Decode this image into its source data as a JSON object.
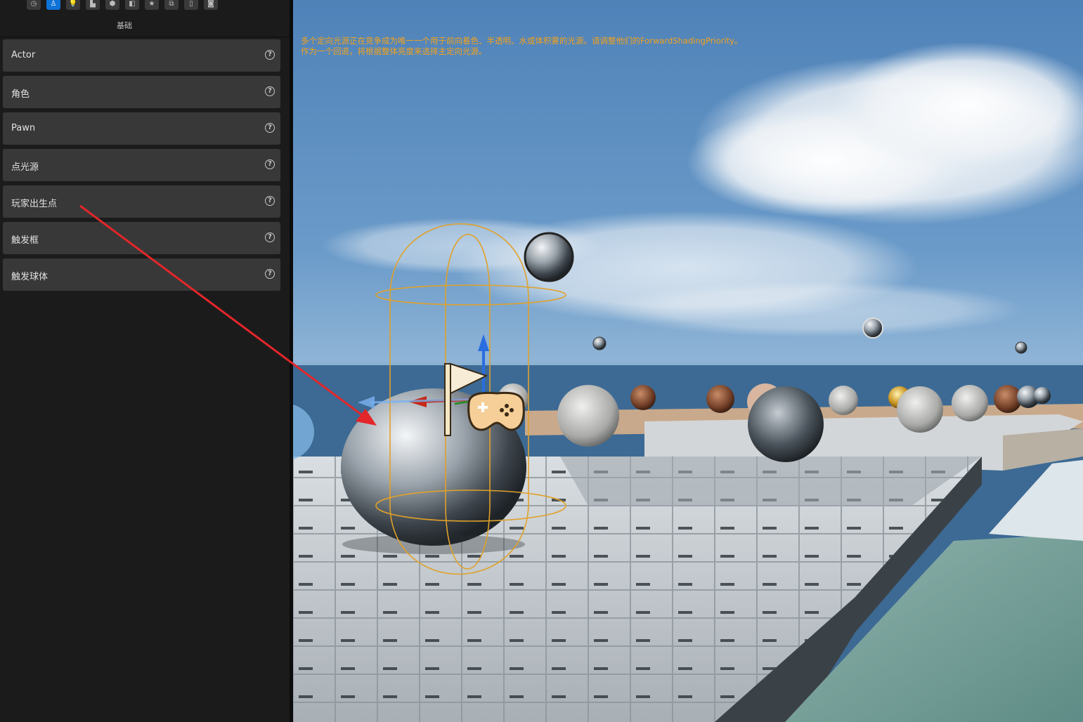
{
  "toolbar": {
    "icons": [
      "recent-icon",
      "basic-actor-icon",
      "lights-icon",
      "shapes-icon",
      "volumes-icon",
      "visual-effects-icon",
      "all-classes-icon",
      "place-icon",
      "docs-icon",
      "geometry-icon"
    ],
    "active_index": 1
  },
  "category": {
    "label": "基础"
  },
  "items": [
    {
      "label": "Actor"
    },
    {
      "label": "角色"
    },
    {
      "label": "Pawn"
    },
    {
      "label": "点光源"
    },
    {
      "label": "玩家出生点"
    },
    {
      "label": "触发框"
    },
    {
      "label": "触发球体"
    }
  ],
  "viewport": {
    "warning_line1": "多个定向光源正在竞争成为唯一一个用于前向着色、半透明、水或体积雾的光源。请调整他们的ForwardShadingPriority。",
    "warning_line2": "作为一个回退，将根据整体亮度来选择主定向光源。"
  },
  "colors": {
    "panel_bg": "#1b1b1b",
    "item_bg": "#383838",
    "accent": "#0f72d6",
    "warning_text": "#f3a21b",
    "annotation_arrow": "#e3262a",
    "capsule_outline": "#e0a12a"
  }
}
